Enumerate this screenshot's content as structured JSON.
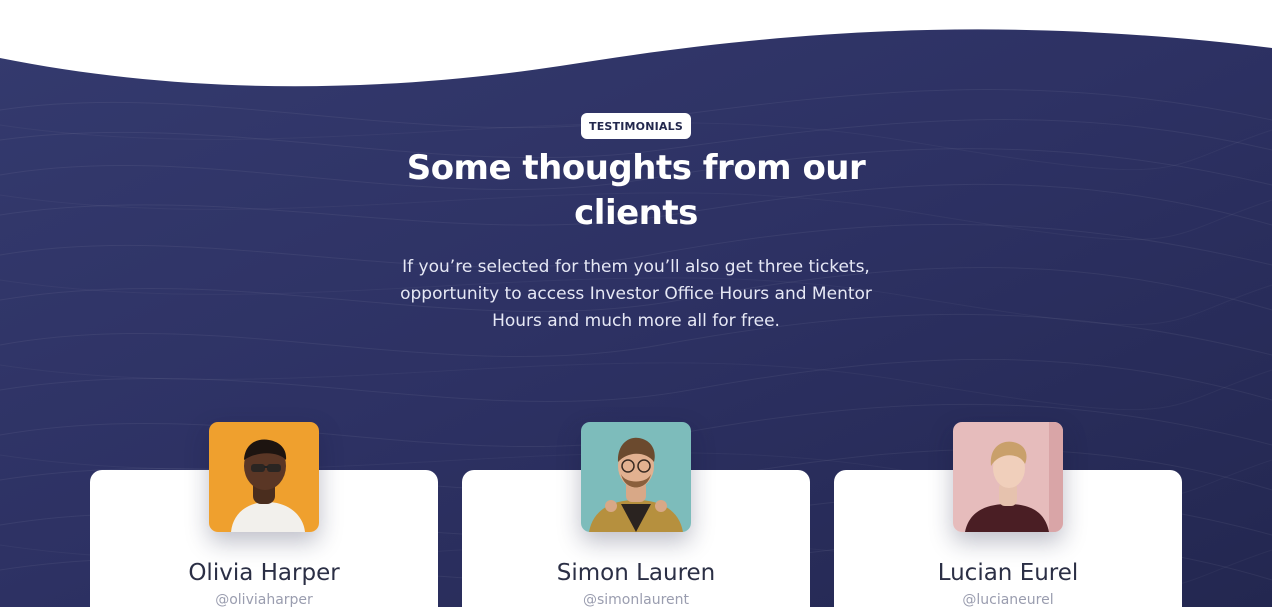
{
  "section": {
    "badge": "TESTIMONIALS",
    "title": "Some thoughts from our clients",
    "subtitle": "If you’re selected for them you’ll also get three tickets, opportunity to access Investor Office Hours and Mentor Hours and much more all for free."
  },
  "colors": {
    "background_navy": "#2d3163",
    "background_navy_dark": "#242850",
    "card": "#ffffff",
    "text_dark": "#2b2f45",
    "handle_gray": "#9a9daf"
  },
  "testimonials": [
    {
      "name": "Olivia Harper",
      "handle": "@oliviaharper",
      "avatar_icon": "avatar-photo-orange"
    },
    {
      "name": "Simon Lauren",
      "handle": "@simonlaurent",
      "avatar_icon": "avatar-photo-teal"
    },
    {
      "name": "Lucian Eurel",
      "handle": "@lucianeurel",
      "avatar_icon": "avatar-photo-pink"
    }
  ]
}
